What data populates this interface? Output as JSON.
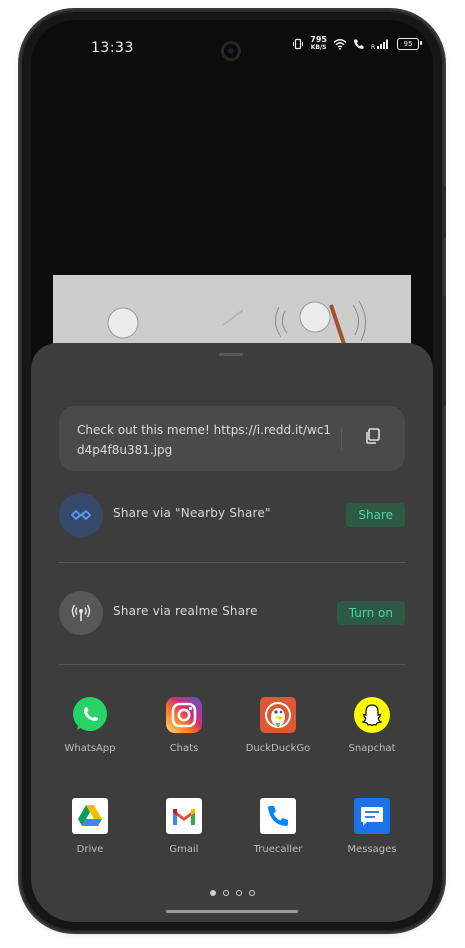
{
  "status_bar": {
    "time": "13:33",
    "speed_value": "795",
    "speed_unit": "KB/S",
    "signal_sub": "R",
    "battery": "95"
  },
  "share_sheet": {
    "link_text": "Check out this meme! https://i.redd.it/wc1d4p4f8u381.jpg",
    "copy_icon": "copy-icon",
    "nearby": {
      "label": "Share via \"Nearby Share\"",
      "action": "Share",
      "icon": "nearby-share-icon"
    },
    "realme": {
      "label": "Share via realme Share",
      "action": "Turn on",
      "icon": "realme-share-icon"
    },
    "apps": [
      {
        "label": "WhatsApp",
        "icon": "whatsapp-icon"
      },
      {
        "label": "Chats",
        "icon": "instagram-icon"
      },
      {
        "label": "DuckDuckGo",
        "icon": "duckduckgo-icon"
      },
      {
        "label": "Snapchat",
        "icon": "snapchat-icon"
      },
      {
        "label": "Drive",
        "icon": "google-drive-icon"
      },
      {
        "label": "Gmail",
        "icon": "gmail-icon"
      },
      {
        "label": "Truecaller",
        "icon": "truecaller-icon"
      },
      {
        "label": "Messages",
        "icon": "messages-icon"
      }
    ],
    "page_indicator": {
      "pages": 4,
      "active": 1
    }
  },
  "colors": {
    "sheet_bg": "#3d3d3d",
    "accent_green": "#4fd79a",
    "accent_green_bg": "#2c5a45"
  }
}
